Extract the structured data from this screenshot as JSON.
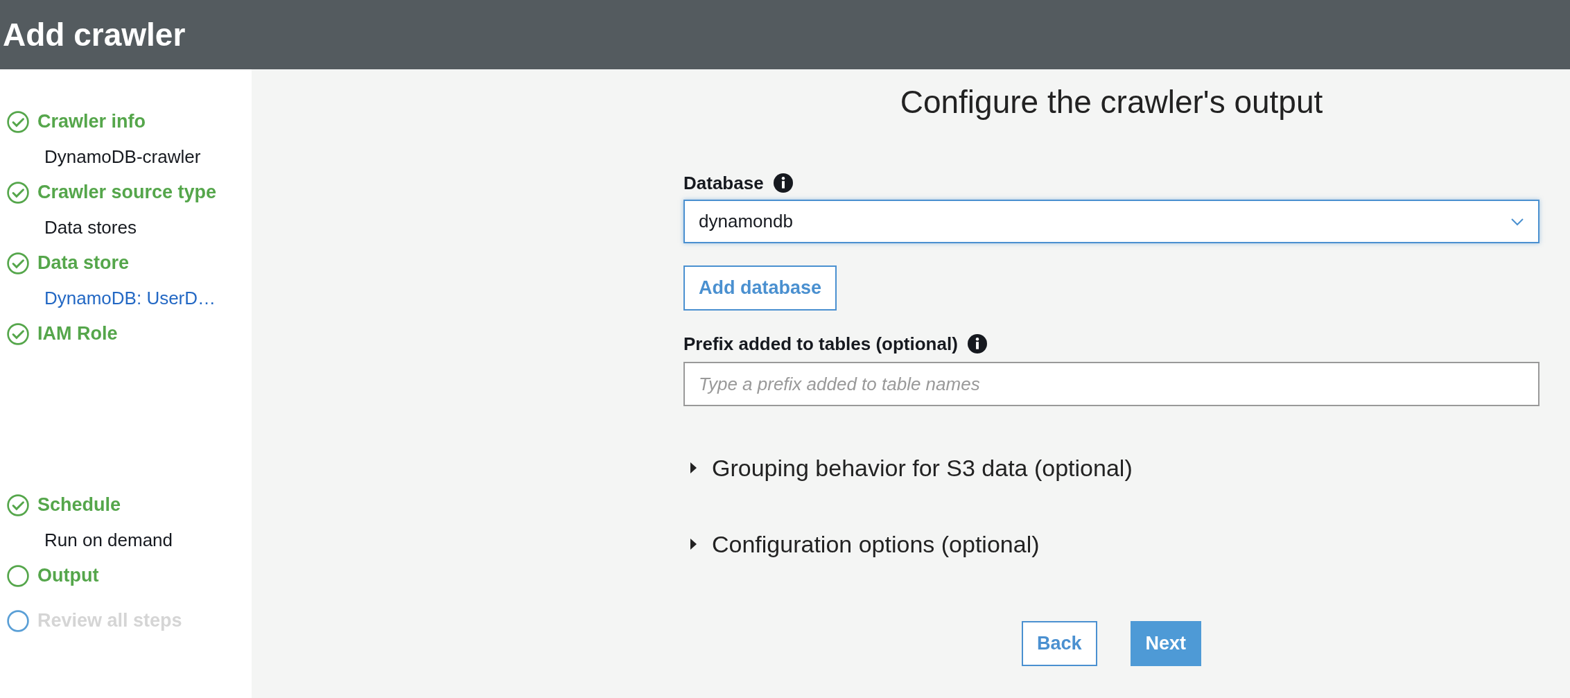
{
  "header": {
    "title": "Add crawler"
  },
  "steps": [
    {
      "title": "Crawler info",
      "kind": "done",
      "detail": {
        "text": "DynamoDB-crawler",
        "link": false
      }
    },
    {
      "title": "Crawler source type",
      "kind": "done",
      "detail": {
        "text": "Data stores",
        "link": false
      }
    },
    {
      "title": "Data store",
      "kind": "done",
      "detail": {
        "text": "DynamoDB: UserD…",
        "link": true
      }
    },
    {
      "title": "IAM Role",
      "kind": "done"
    },
    {
      "title": "Schedule",
      "kind": "done",
      "detail": {
        "text": "Run on demand",
        "link": false
      }
    },
    {
      "title": "Output",
      "kind": "current"
    },
    {
      "title": "Review all steps",
      "kind": "pending"
    }
  ],
  "main": {
    "heading": "Configure the crawler's output",
    "database": {
      "label": "Database",
      "value": "dynamondb",
      "add_button": "Add database"
    },
    "prefix": {
      "label": "Prefix added to tables (optional)",
      "placeholder": "Type a prefix added to table names"
    },
    "sections": [
      {
        "label": "Grouping behavior for S3 data (optional)",
        "expanded": false
      },
      {
        "label": "Configuration options (optional)",
        "expanded": false
      }
    ],
    "buttons": {
      "back": "Back",
      "next": "Next"
    }
  }
}
